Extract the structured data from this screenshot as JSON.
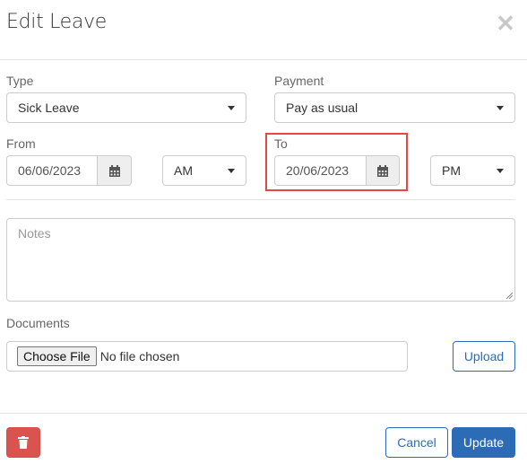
{
  "modal": {
    "title": "Edit Leave",
    "close_icon": "close-icon"
  },
  "form": {
    "type": {
      "label": "Type",
      "value": "Sick Leave"
    },
    "payment": {
      "label": "Payment",
      "value": "Pay as usual"
    },
    "from": {
      "label": "From",
      "date": "06/06/2023",
      "period": "AM",
      "icon": "calendar-icon"
    },
    "to": {
      "label": "To",
      "date": "20/06/2023",
      "period": "PM",
      "icon": "calendar-icon"
    },
    "notes": {
      "placeholder": "Notes",
      "value": ""
    },
    "documents": {
      "label": "Documents",
      "choose_file_label": "Choose File",
      "file_status": "No file chosen",
      "upload_label": "Upload"
    }
  },
  "footer": {
    "delete_icon": "trash-icon",
    "cancel_label": "Cancel",
    "update_label": "Update"
  },
  "colors": {
    "primary": "#2c6cb7",
    "danger": "#d9534f",
    "highlight": "#e84545"
  }
}
